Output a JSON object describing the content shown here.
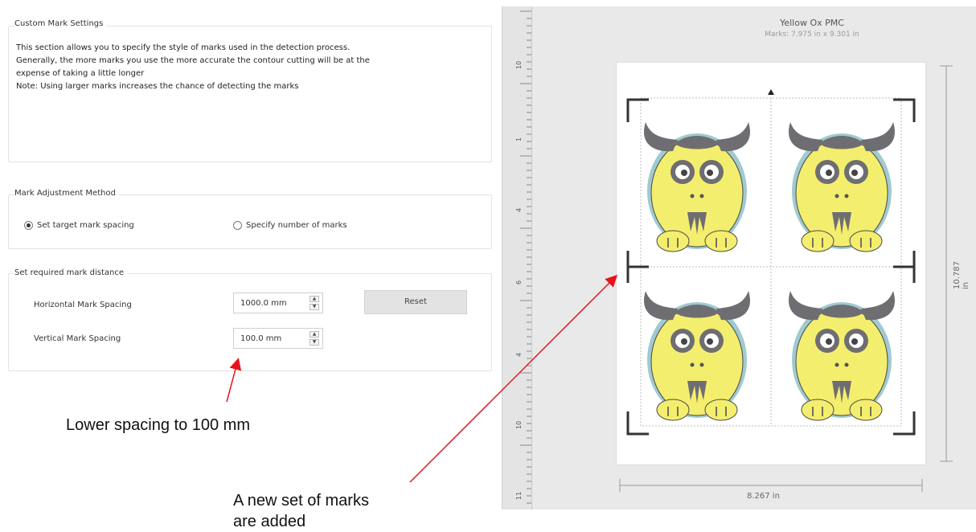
{
  "custom_mark_settings": {
    "title": "Custom Mark Settings",
    "description": [
      "This section allows you to specify the style of marks used in the detection process.",
      "Generally, the more marks you use the more accurate the contour cutting will be at the",
      "expense of taking a little longer",
      "Note: Using larger marks increases the chance of detecting the marks"
    ]
  },
  "mark_adjustment": {
    "title": "Mark Adjustment Method",
    "options": [
      {
        "label": "Set target mark spacing",
        "selected": true
      },
      {
        "label": "Specify number of marks",
        "selected": false
      }
    ]
  },
  "mark_distance": {
    "title": "Set required mark distance",
    "horizontal_label": "Horizontal Mark Spacing",
    "horizontal_value": "1000.0 mm",
    "vertical_label": "Vertical Mark Spacing",
    "vertical_value": "100.0 mm",
    "reset_label": "Reset"
  },
  "annotations": {
    "spacing_note": "Lower spacing to 100 mm",
    "marks_note_line1": "A new set of marks",
    "marks_note_line2": "are added",
    "arrow_color": "#e8141b"
  },
  "preview": {
    "title": "Yellow Ox PMC",
    "subtitle": "Marks: 7.975 in x 9.301 in",
    "width_label": "8.267 in",
    "height_label": "10.787 in",
    "ruler_labels": [
      "10",
      "1",
      "4",
      "6",
      "4",
      "10",
      "11"
    ],
    "colors": {
      "ox_body": "#f4ee6e",
      "ox_outline": "#9fcad0",
      "horns": "#6e6e72",
      "marks": "#333333"
    }
  }
}
